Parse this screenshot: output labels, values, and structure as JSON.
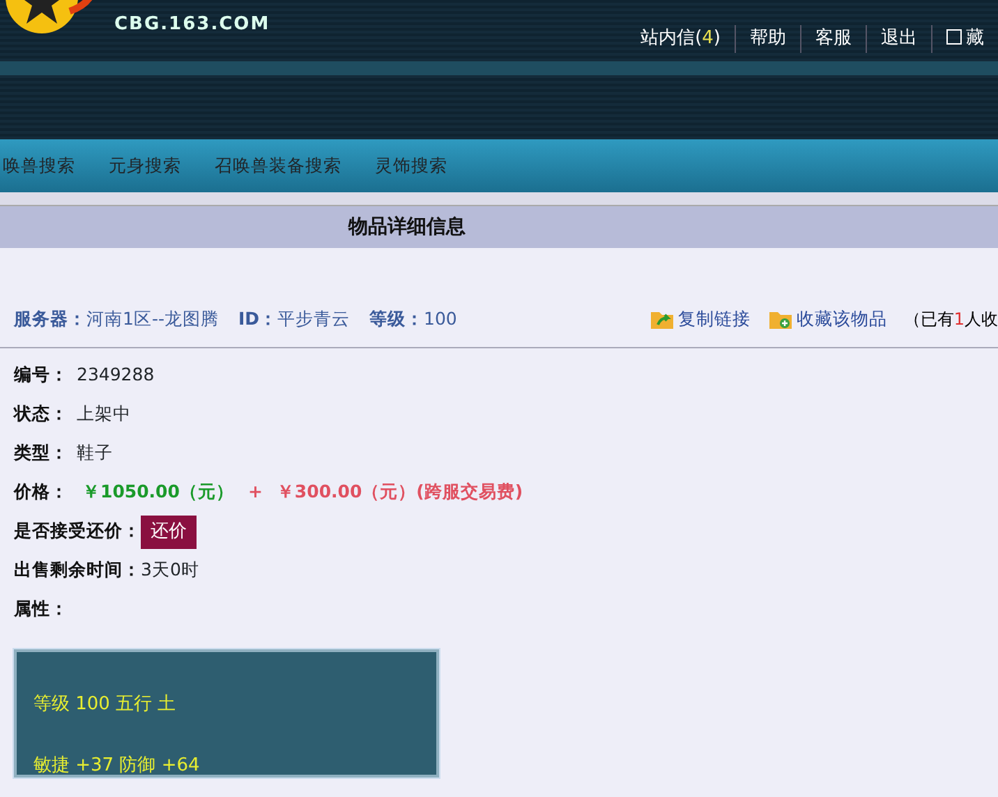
{
  "header": {
    "logo_domain": "CBG.163.COM",
    "links": [
      {
        "label": "站内信(",
        "count": "4",
        "suffix": ")"
      },
      {
        "label": "帮助"
      },
      {
        "label": "客服"
      },
      {
        "label": "退出"
      },
      {
        "label": "藏",
        "kind": "checkbox"
      }
    ]
  },
  "nav": {
    "items": [
      "唤兽搜索",
      "元身搜索",
      "召唤兽装备搜索",
      "灵饰搜索"
    ]
  },
  "section_title": "物品详细信息",
  "summary": {
    "fields": [
      {
        "label": "服务器：",
        "value": "河南1区--龙图腾"
      },
      {
        "label": "ID：",
        "value": "平步青云"
      },
      {
        "label": "等级：",
        "value": "100"
      }
    ],
    "actions": [
      "复制链接",
      "收藏该物品"
    ],
    "collect_note": {
      "prefix": "（已有",
      "count": "1",
      "suffix": "人收"
    }
  },
  "details": [
    {
      "kind": "text",
      "label": "编号：",
      "value": "2349288"
    },
    {
      "kind": "text",
      "label": "状态：",
      "value": "上架中"
    },
    {
      "kind": "text",
      "label": "类型：",
      "value": "鞋子"
    },
    {
      "kind": "price",
      "label": "价格：",
      "price": "￥1050.00（元）",
      "plus": "+",
      "fee": "￥300.00（元）(跨服交易费)"
    },
    {
      "kind": "button",
      "label": "是否接受还价：",
      "button": "还价"
    },
    {
      "kind": "text",
      "label": "出售剩余时间：",
      "value": "3天0时"
    },
    {
      "kind": "text",
      "label": "属性："
    }
  ],
  "attributes": [
    "等级 100 五行 土",
    "敏捷 +37 防御 +64"
  ]
}
